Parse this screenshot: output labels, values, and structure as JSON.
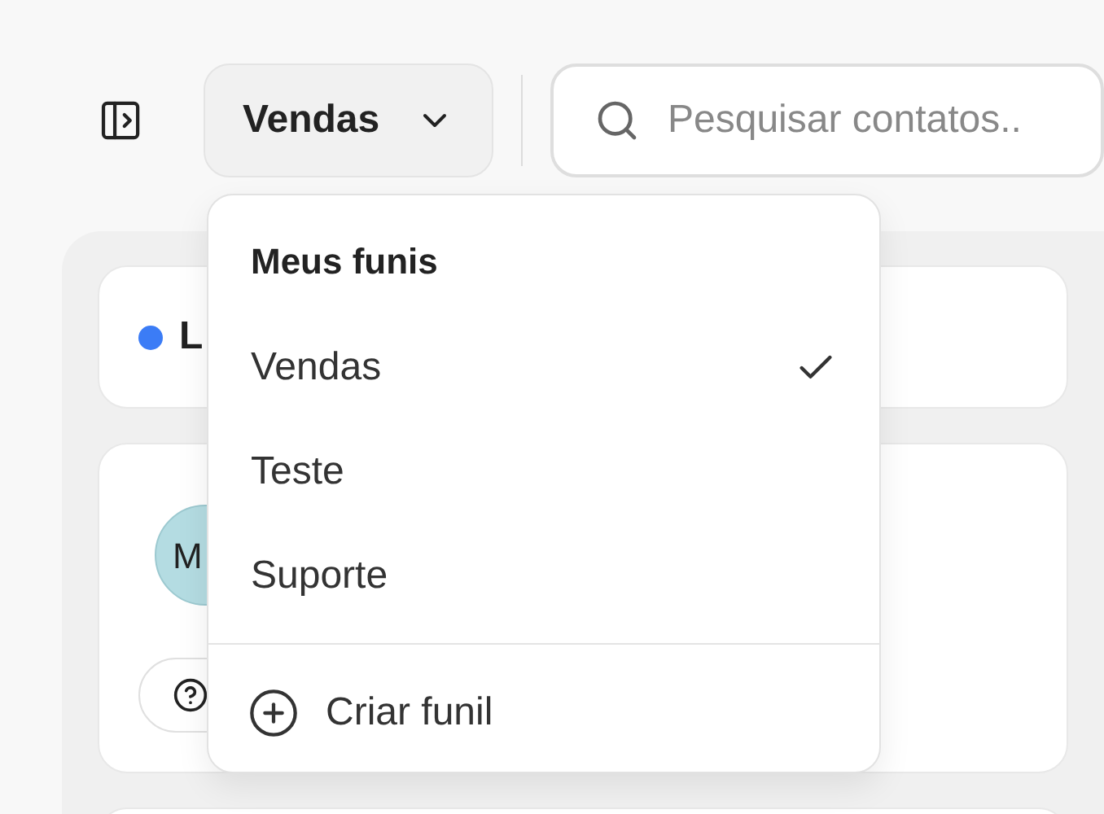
{
  "toolbar": {
    "funnel_button": {
      "label": "Vendas",
      "expanded": true
    },
    "search": {
      "placeholder": "Pesquisar contatos.."
    }
  },
  "column": {
    "title": "L",
    "color": "#3b7cf6"
  },
  "card": {
    "avatar": "M"
  },
  "dropdown": {
    "heading": "Meus funis",
    "items": [
      {
        "label": "Vendas",
        "selected": true
      },
      {
        "label": "Teste",
        "selected": false
      },
      {
        "label": "Suporte",
        "selected": false
      }
    ],
    "create_label": "Criar funil"
  }
}
